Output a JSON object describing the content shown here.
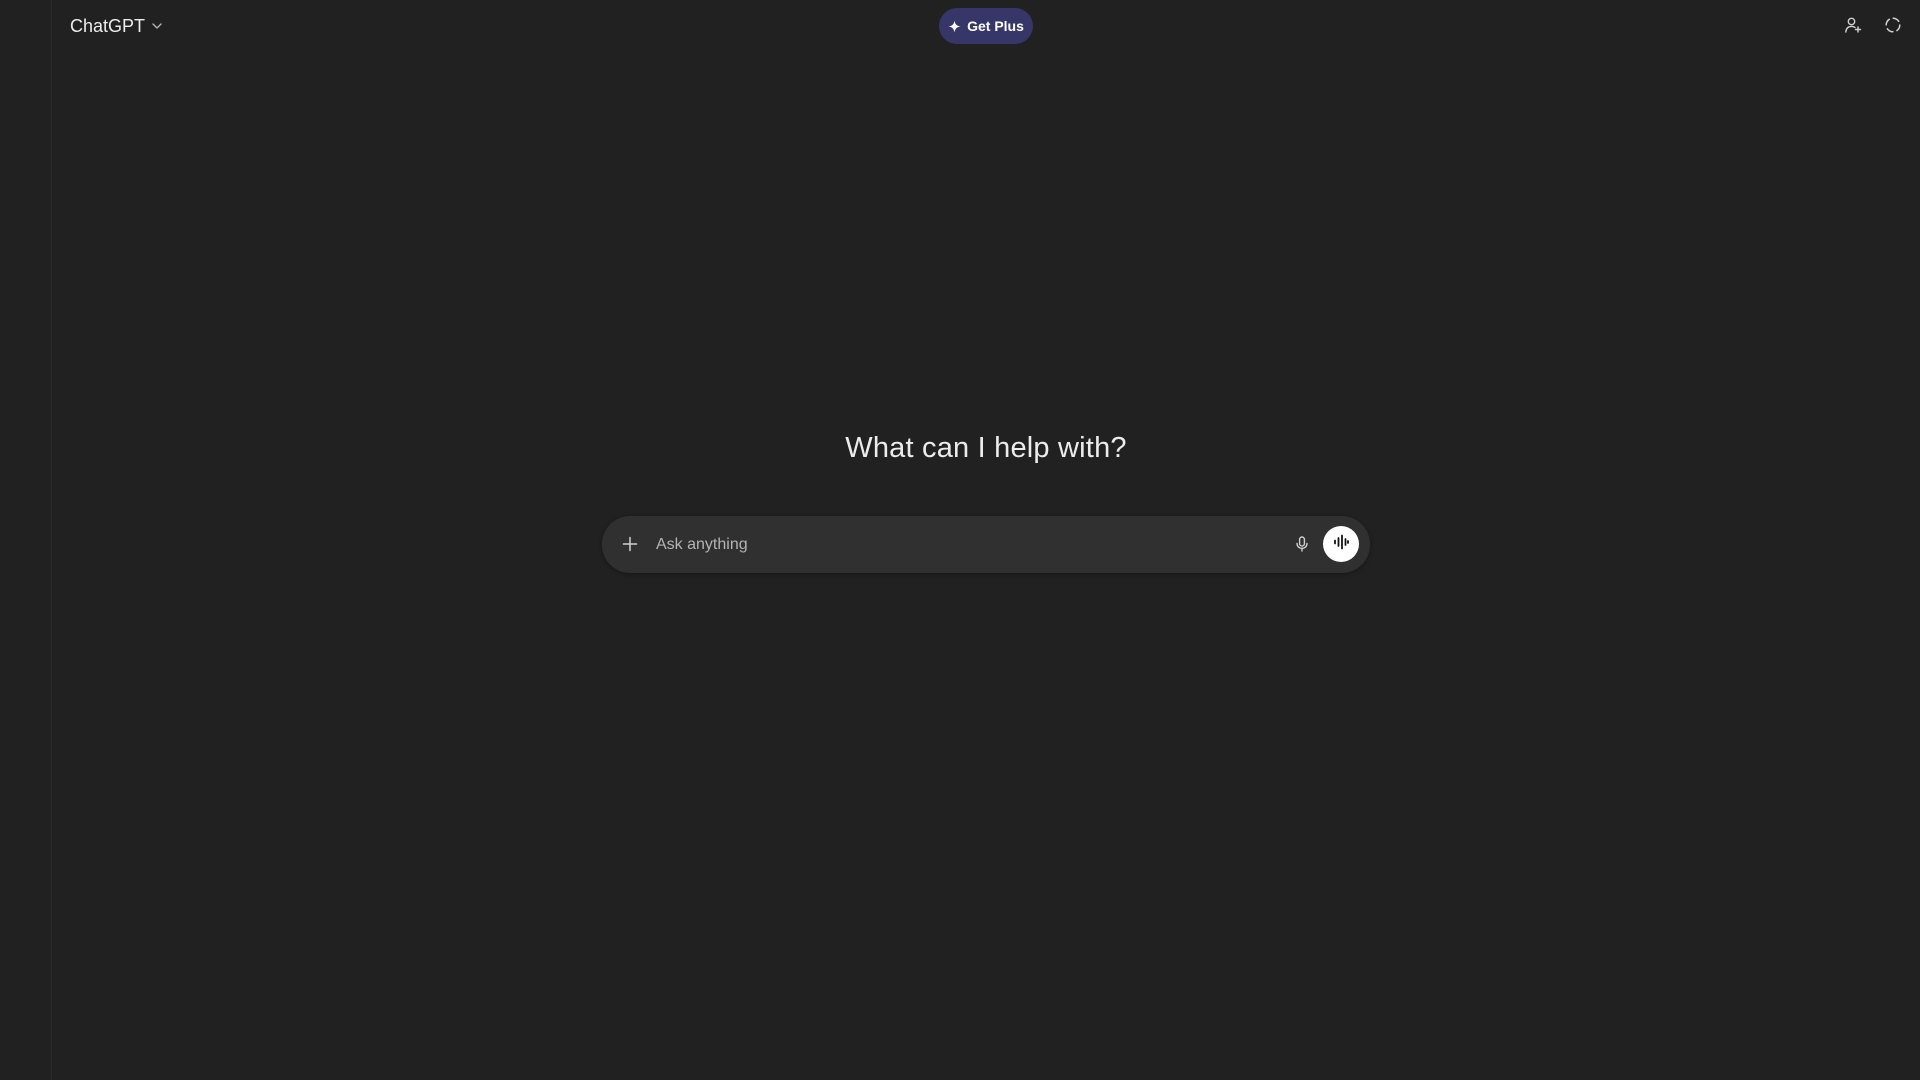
{
  "header": {
    "model_label": "ChatGPT",
    "upgrade_label": "Get Plus",
    "upgrade_color": "#373669"
  },
  "main": {
    "greeting": "What can I help with?"
  },
  "composer": {
    "placeholder": "Ask anything"
  },
  "icons": {
    "model_dropdown": "chevron-down-icon",
    "upgrade": "sparkle-icon",
    "invite": "add-person-icon",
    "temporary_chat": "dashed-circle-icon",
    "attach": "plus-icon",
    "dictate": "microphone-icon",
    "voice_mode": "voice-waveform-icon"
  },
  "colors": {
    "background": "#212121",
    "composer_background": "#303030",
    "text": "#ececec"
  }
}
